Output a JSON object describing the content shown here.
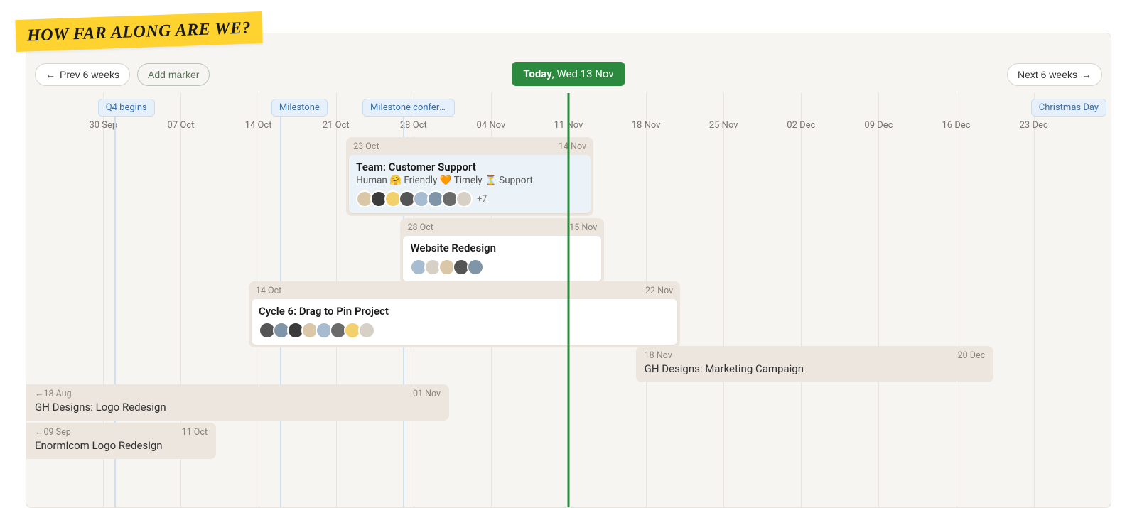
{
  "headline": "How far along are we?",
  "toolbar": {
    "prev_label": "Prev 6 weeks",
    "add_marker_label": "Add marker",
    "next_label": "Next 6 weeks"
  },
  "today": {
    "bold": "Today",
    "rest": ", Wed 13 Nov"
  },
  "grid_labels": [
    "30 Sep",
    "07 Oct",
    "14 Oct",
    "21 Oct",
    "28 Oct",
    "04 Nov",
    "11 Nov",
    "18 Nov",
    "25 Nov",
    "02 Dec",
    "09 Dec",
    "16 Dec",
    "23 Dec"
  ],
  "markers": {
    "q4": "Q4 begins",
    "milestone": "Milestone",
    "conf": "Milestone conferen…",
    "xmas": "Christmas Day"
  },
  "bars": {
    "team": {
      "start": "23 Oct",
      "end": "14 Nov",
      "title": "Team: Customer Support",
      "sub": "Human 🤗 Friendly 🧡 Timely ⏳ Support",
      "avatar_more": "+7"
    },
    "website": {
      "start": "28 Oct",
      "end": "15 Nov",
      "title": "Website Redesign"
    },
    "cycle6": {
      "start": "14 Oct",
      "end": "22 Nov",
      "title": "Cycle 6: Drag to Pin Project"
    },
    "marketing": {
      "start": "18 Nov",
      "end": "20 Dec",
      "title": "GH Designs: Marketing Campaign"
    },
    "logo": {
      "start": "18 Aug",
      "end": "01 Nov",
      "title": "GH Designs: Logo Redesign"
    },
    "enormicom": {
      "start": "09 Sep",
      "end": "11 Oct",
      "title": "Enormicom Logo Redesign"
    }
  }
}
